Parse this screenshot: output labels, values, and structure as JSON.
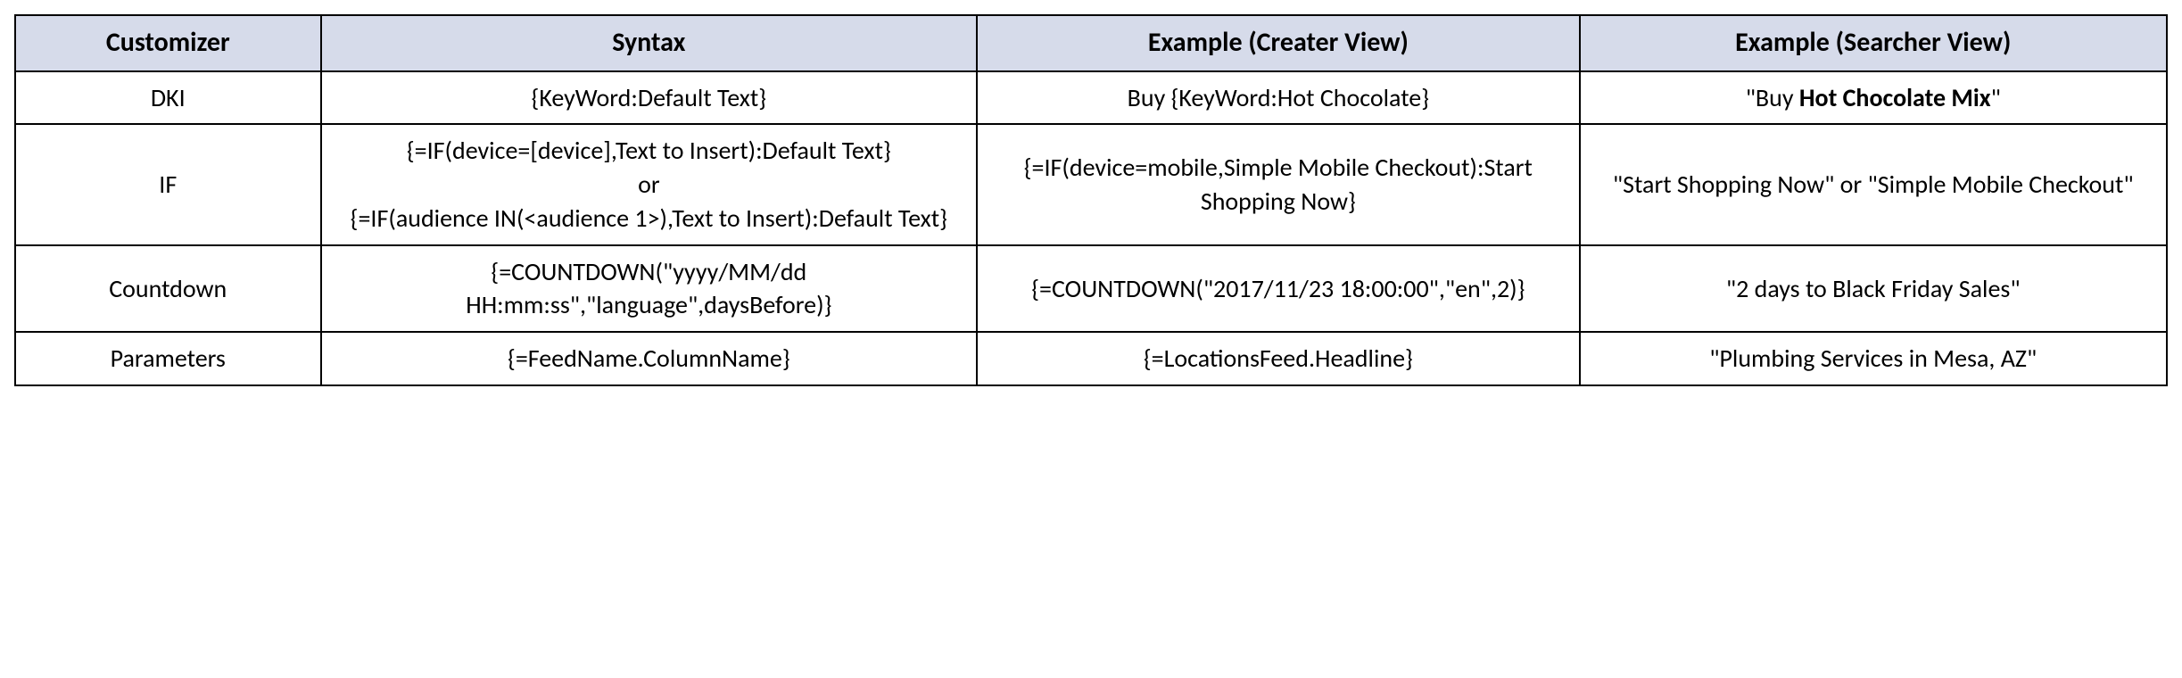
{
  "table": {
    "headers": {
      "customizer": "Customizer",
      "syntax": "Syntax",
      "creator": "Example (Creater View)",
      "searcher": "Example (Searcher View)"
    },
    "rows": [
      {
        "customizer": "DKI",
        "syntax": "{KeyWord:Default Text}",
        "creator": "Buy {KeyWord:Hot Chocolate}",
        "searcher_prefix": "\"Buy ",
        "searcher_bold": "Hot Chocolate Mix",
        "searcher_suffix": "\""
      },
      {
        "customizer": "IF",
        "syntax_line1": "{=IF(device=[device],Text to Insert):Default Text}",
        "syntax_or": "or",
        "syntax_line2": "{=IF(audience IN(<audience 1>),Text to Insert):Default Text}",
        "creator": "{=IF(device=mobile,Simple Mobile Checkout):Start Shopping Now}",
        "searcher": "\"Start Shopping Now\" or \"Simple Mobile Checkout\""
      },
      {
        "customizer": "Countdown",
        "syntax": "{=COUNTDOWN(\"yyyy/MM/dd HH:mm:ss\",\"language\",daysBefore)}",
        "creator": "{=COUNTDOWN(\"2017/11/23 18:00:00\",\"en\",2)}",
        "searcher": "\"2 days to Black Friday Sales\""
      },
      {
        "customizer": "Parameters",
        "syntax": "{=FeedName.ColumnName}",
        "creator": "{=LocationsFeed.Headline}",
        "searcher": "\"Plumbing Services in Mesa, AZ\""
      }
    ]
  }
}
